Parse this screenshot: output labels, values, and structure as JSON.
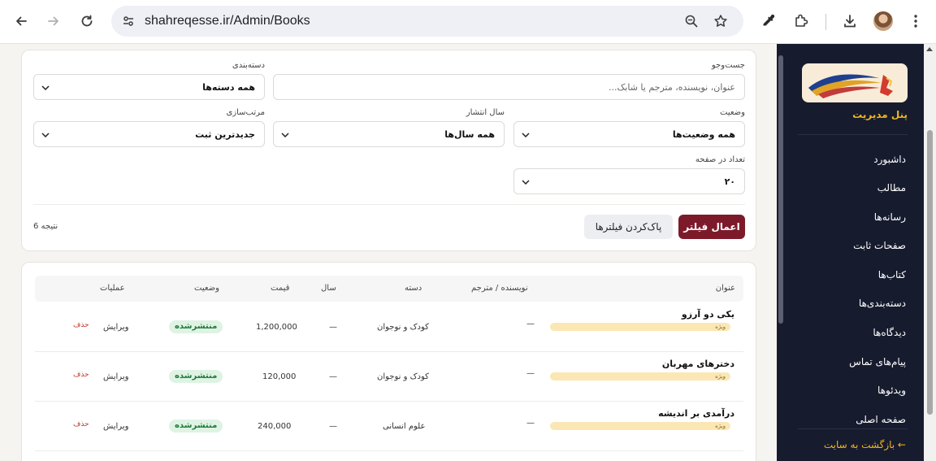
{
  "browser": {
    "url": "shahreqesse.ir/Admin/Books"
  },
  "sidebar": {
    "panel_label": "پنل مدیریت",
    "items": [
      {
        "label": "داشبورد"
      },
      {
        "label": "مطالب"
      },
      {
        "label": "رسانه‌ها"
      },
      {
        "label": "صفحات ثابت"
      },
      {
        "label": "کتاب‌ها"
      },
      {
        "label": "دسته‌بندی‌ها"
      },
      {
        "label": "دیدگاه‌ها"
      },
      {
        "label": "پیام‌های تماس"
      },
      {
        "label": "ویدئوها"
      },
      {
        "label": "صفحه اصلی"
      }
    ],
    "back_link": "← بازگشت به سایت"
  },
  "filters": {
    "search_label": "جست‌وجو",
    "search_placeholder": "عنوان، نویسنده، مترجم یا شابک...",
    "category_label": "دسته‌بندی",
    "category_value": "همه دسته‌ها",
    "status_label": "وضعیت",
    "status_value": "همه وضعیت‌ها",
    "year_label": "سال انتشار",
    "year_value": "همه سال‌ها",
    "sort_label": "مرتب‌سازی",
    "sort_value": "جدیدترین ثبت",
    "per_page_label": "تعداد در صفحه",
    "per_page_value": "۲۰",
    "apply_label": "اعمال فیلتر",
    "clear_label": "پاک‌کردن فیلترها",
    "result_count": "6 نتیجه"
  },
  "table": {
    "headers": {
      "title": "عنوان",
      "author": "نویسنده / مترجم",
      "category": "دسته",
      "year": "سال",
      "price": "قیمت",
      "status": "وضعیت",
      "actions": "عملیات"
    },
    "rows": [
      {
        "title": "یکی دو آرزو",
        "badge": "ویژه",
        "author": "—",
        "category": "کودک و نوجوان",
        "year": "—",
        "price": "1,200,000",
        "status": "منتشرشده",
        "edit": "ویرایش",
        "delete": "حذف"
      },
      {
        "title": "دخترهای مهربان",
        "badge": "ویژه",
        "author": "—",
        "category": "کودک و نوجوان",
        "year": "—",
        "price": "120,000",
        "status": "منتشرشده",
        "edit": "ویرایش",
        "delete": "حذف"
      },
      {
        "title": "درآمدی بر اندیشه",
        "badge": "ویژه",
        "author": "—",
        "category": "علوم انسانی",
        "year": "—",
        "price": "240,000",
        "status": "منتشرشده",
        "edit": "ویرایش",
        "delete": "حذف"
      }
    ]
  },
  "colors": {
    "sidebar_bg": "#171b2e",
    "accent_gold": "#f2b61a",
    "primary_button": "#7d1a2a",
    "status_badge_bg": "#dff3e4",
    "feature_badge_bg": "#fbe7b4"
  },
  "icons": [
    "back-arrow-icon",
    "forward-arrow-icon",
    "reload-icon",
    "site-settings-icon",
    "zoom-icon",
    "bookmark-star-icon",
    "eyedropper-icon",
    "extensions-icon",
    "download-icon",
    "menu-dots-icon",
    "chevron-down-icon"
  ]
}
